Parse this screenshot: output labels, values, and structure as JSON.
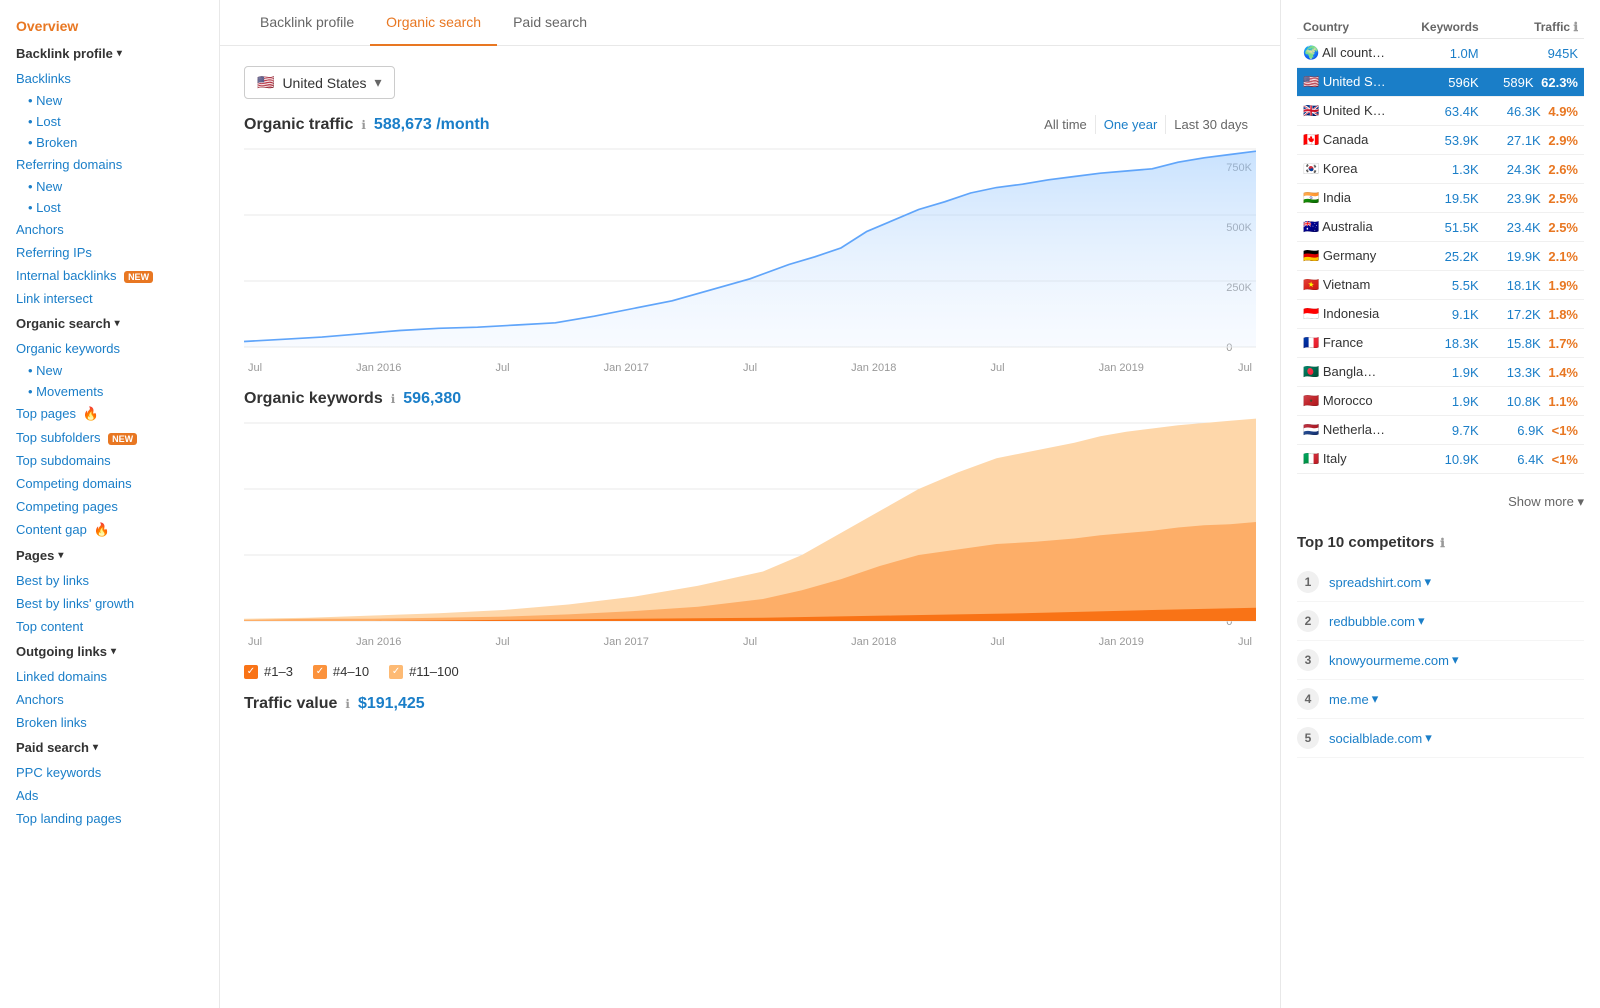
{
  "sidebar": {
    "overview": "Overview",
    "sections": [
      {
        "label": "Backlink profile",
        "items": [
          {
            "label": "Backlinks",
            "sub": false
          },
          {
            "label": "New",
            "sub": true
          },
          {
            "label": "Lost",
            "sub": true
          },
          {
            "label": "Broken",
            "sub": true
          }
        ]
      },
      {
        "label": "Referring domains",
        "items": [
          {
            "label": "New",
            "sub": true
          },
          {
            "label": "Lost",
            "sub": true
          }
        ]
      },
      {
        "label": "Anchors",
        "items": []
      },
      {
        "label": "Referring IPs",
        "items": []
      },
      {
        "label": "Internal backlinks",
        "badge": "NEW",
        "items": []
      },
      {
        "label": "Link intersect",
        "items": []
      },
      {
        "label": "Organic search",
        "items": [
          {
            "label": "Organic keywords",
            "sub": false
          },
          {
            "label": "New",
            "sub": true
          },
          {
            "label": "Movements",
            "sub": true
          }
        ]
      },
      {
        "label": "Top pages",
        "fire": true,
        "items": []
      },
      {
        "label": "Top subfolders",
        "badge": "NEW",
        "items": []
      },
      {
        "label": "Top subdomains",
        "items": []
      },
      {
        "label": "Competing domains",
        "items": []
      },
      {
        "label": "Competing pages",
        "items": []
      },
      {
        "label": "Content gap",
        "fire": true,
        "items": []
      },
      {
        "label": "Pages",
        "items": [
          {
            "label": "Best by links",
            "sub": false
          },
          {
            "label": "Best by links' growth",
            "sub": false
          },
          {
            "label": "Top content",
            "sub": false
          }
        ]
      },
      {
        "label": "Outgoing links",
        "items": [
          {
            "label": "Linked domains",
            "sub": false
          },
          {
            "label": "Anchors",
            "sub": false
          },
          {
            "label": "Broken links",
            "sub": false
          }
        ]
      },
      {
        "label": "Paid search",
        "items": [
          {
            "label": "PPC keywords",
            "sub": false
          },
          {
            "label": "Ads",
            "sub": false
          },
          {
            "label": "Top landing pages",
            "sub": false
          }
        ]
      }
    ]
  },
  "tabs": [
    "Backlink profile",
    "Organic search",
    "Paid search"
  ],
  "active_tab": 1,
  "country_selector": "United States",
  "organic_traffic": {
    "label": "Organic traffic",
    "value": "588,673 /month",
    "time_filters": [
      "All time",
      "One year",
      "Last 30 days"
    ],
    "active_time": 0
  },
  "organic_keywords": {
    "label": "Organic keywords",
    "value": "596,380"
  },
  "traffic_value": {
    "label": "Traffic value",
    "value": "$191,425"
  },
  "chart_y_labels_traffic": [
    "750K",
    "500K",
    "250K",
    "0"
  ],
  "chart_x_labels": [
    "Jul",
    "Jan 2016",
    "Jul",
    "Jan 2017",
    "Jul",
    "Jan 2018",
    "Jul",
    "Jan 2019",
    "Jul"
  ],
  "chart_legend": [
    {
      "label": "#1–3",
      "color": "#f97316"
    },
    {
      "label": "#4–10",
      "color": "#fb923c"
    },
    {
      "label": "#11–100",
      "color": "#fed7aa"
    }
  ],
  "right_panel": {
    "table_headers": [
      "Country",
      "Keywords",
      "Traffic"
    ],
    "rows": [
      {
        "flag": "🌍",
        "name": "All count…",
        "keywords": "1.0M",
        "traffic": "945K",
        "pct": "",
        "selected": false
      },
      {
        "flag": "🇺🇸",
        "name": "United S…",
        "keywords": "596K",
        "traffic": "589K",
        "pct": "62.3%",
        "selected": true
      },
      {
        "flag": "🇬🇧",
        "name": "United K…",
        "keywords": "63.4K",
        "traffic": "46.3K",
        "pct": "4.9%",
        "selected": false
      },
      {
        "flag": "🇨🇦",
        "name": "Canada",
        "keywords": "53.9K",
        "traffic": "27.1K",
        "pct": "2.9%",
        "selected": false
      },
      {
        "flag": "🇰🇷",
        "name": "Korea",
        "keywords": "1.3K",
        "traffic": "24.3K",
        "pct": "2.6%",
        "selected": false
      },
      {
        "flag": "🇮🇳",
        "name": "India",
        "keywords": "19.5K",
        "traffic": "23.9K",
        "pct": "2.5%",
        "selected": false
      },
      {
        "flag": "🇦🇺",
        "name": "Australia",
        "keywords": "51.5K",
        "traffic": "23.4K",
        "pct": "2.5%",
        "selected": false
      },
      {
        "flag": "🇩🇪",
        "name": "Germany",
        "keywords": "25.2K",
        "traffic": "19.9K",
        "pct": "2.1%",
        "selected": false
      },
      {
        "flag": "🇻🇳",
        "name": "Vietnam",
        "keywords": "5.5K",
        "traffic": "18.1K",
        "pct": "1.9%",
        "selected": false
      },
      {
        "flag": "🇮🇩",
        "name": "Indonesia",
        "keywords": "9.1K",
        "traffic": "17.2K",
        "pct": "1.8%",
        "selected": false
      },
      {
        "flag": "🇫🇷",
        "name": "France",
        "keywords": "18.3K",
        "traffic": "15.8K",
        "pct": "1.7%",
        "selected": false
      },
      {
        "flag": "🇧🇩",
        "name": "Bangla…",
        "keywords": "1.9K",
        "traffic": "13.3K",
        "pct": "1.4%",
        "selected": false
      },
      {
        "flag": "🇲🇦",
        "name": "Morocco",
        "keywords": "1.9K",
        "traffic": "10.8K",
        "pct": "1.1%",
        "selected": false
      },
      {
        "flag": "🇳🇱",
        "name": "Netherla…",
        "keywords": "9.7K",
        "traffic": "6.9K",
        "pct": "<1%",
        "selected": false
      },
      {
        "flag": "🇮🇹",
        "name": "Italy",
        "keywords": "10.9K",
        "traffic": "6.4K",
        "pct": "<1%",
        "selected": false
      }
    ],
    "show_more": "Show more ▾",
    "competitors_title": "Top 10 competitors",
    "competitors": [
      {
        "num": 1,
        "domain": "spreadshirt.com"
      },
      {
        "num": 2,
        "domain": "redbubble.com"
      },
      {
        "num": 3,
        "domain": "knowyourmeme.com"
      },
      {
        "num": 4,
        "domain": "me.me"
      },
      {
        "num": 5,
        "domain": "socialblade.com"
      }
    ]
  }
}
